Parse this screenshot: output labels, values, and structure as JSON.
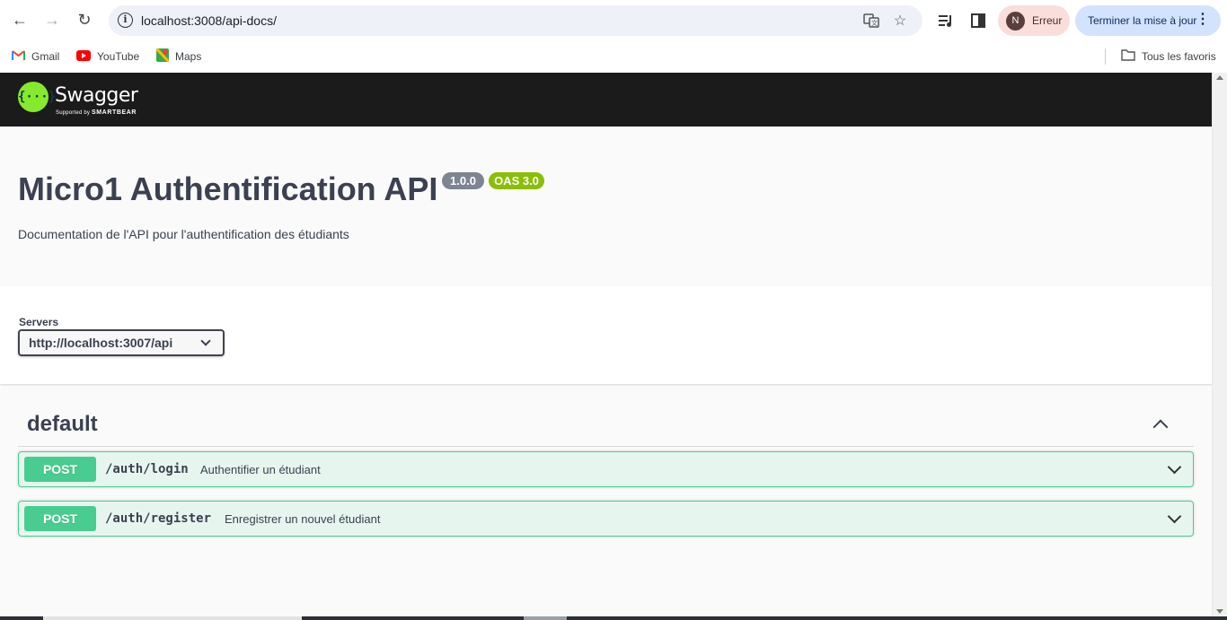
{
  "browser": {
    "url": "localhost:3008/api-docs/",
    "profile_initial": "N",
    "profile_label": "Erreur",
    "update_label": "Terminer la mise à jour",
    "bookmarks": [
      "Gmail",
      "YouTube",
      "Maps"
    ],
    "all_bookmarks_label": "Tous les favoris"
  },
  "swagger": {
    "logo_symbol": "{···}",
    "logo_text": "Swagger",
    "logo_sub_prefix": "Supported by",
    "logo_sub_brand": "SMARTBEAR"
  },
  "info": {
    "title": "Micro1 Authentification API",
    "version": "1.0.0",
    "oas": "OAS 3.0",
    "description": "Documentation de l'API pour l'authentification des étudiants"
  },
  "servers": {
    "label": "Servers",
    "selected": "http://localhost:3007/api"
  },
  "operations": {
    "tag": "default",
    "items": [
      {
        "method": "POST",
        "path": "/auth/login",
        "summary": "Authentifier un étudiant"
      },
      {
        "method": "POST",
        "path": "/auth/register",
        "summary": "Enregistrer un nouvel étudiant"
      }
    ]
  },
  "colors": {
    "post": "#49cc90",
    "swagger_green": "#85ea2d",
    "version_badge": "#7d8492",
    "oas_badge": "#89bf04"
  }
}
